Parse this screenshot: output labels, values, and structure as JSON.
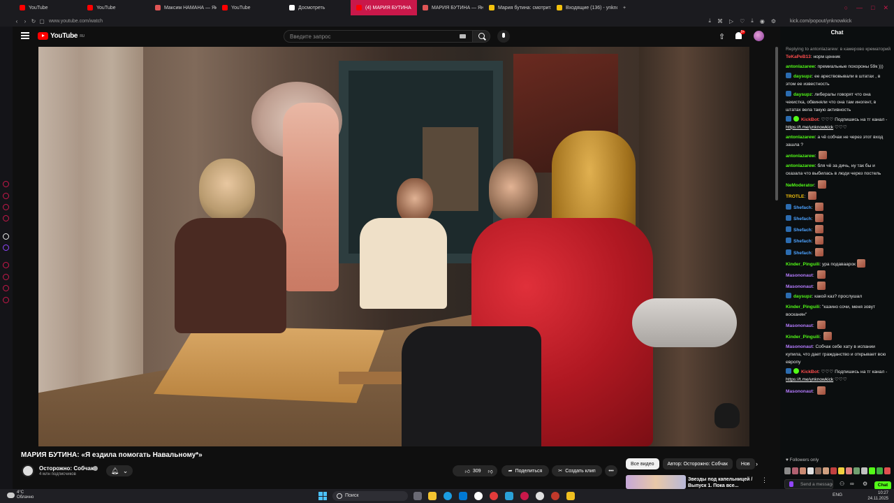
{
  "browser": {
    "tabs": [
      {
        "label": "YouTube",
        "favicon_color": "#ff0000",
        "active": false
      },
      {
        "label": "YouTube",
        "favicon_color": "#ff0000",
        "active": false
      },
      {
        "label": "Максим НАМАНА — Як...",
        "favicon_color": "#e05555",
        "active": false
      },
      {
        "label": "YouTube",
        "favicon_color": "#ff0000",
        "active": false
      },
      {
        "label": "Досмотреть",
        "favicon_color": "#ffffff",
        "active": false
      },
      {
        "label": "(4) МАРИЯ БУТИНА",
        "favicon_color": "#ff0000",
        "active": true
      },
      {
        "label": "МАРИЯ БУТИНА — Янд...",
        "favicon_color": "#e05555",
        "active": false
      },
      {
        "label": "Мария бутина: смотрит...",
        "favicon_color": "#f4c20d",
        "active": false
      },
      {
        "label": "Входящие (136) - ynkno...",
        "favicon_color": "#f4c20d",
        "active": false
      }
    ],
    "new_tab_label": "+",
    "url": "www.youtube.com/watch",
    "accent": "#c9184a"
  },
  "youtube": {
    "logo": "YouTube",
    "logo_region": "RU",
    "search_placeholder": "Введите запрос",
    "notification_count": "9+",
    "video": {
      "title": "МАРИЯ БУТИНА: «Я ездила помогать Навальному*»",
      "channel": "Осторожно: Собчак",
      "subscribers": "4 млн подписчиков",
      "likes": "309",
      "share_label": "Поделиться",
      "clip_label": "Создать клип",
      "more_label": "•••"
    },
    "filters": [
      "Все видео",
      "Автор: Осторожно: Собчак",
      "Нов"
    ],
    "recommended": {
      "title": "Звезды под капельницей / Выпуск 1. Пока все..."
    }
  },
  "chat": {
    "url": "kick.com/popout/ynknowkick",
    "header": "Chat",
    "messages": [
      {
        "reply": "Replying to antonlazarew: в камерово крематорий...",
        "user": "TeKaPeB13",
        "color": "#ff4d4d",
        "text": "норм ценник"
      },
      {
        "user": "antonlazarew",
        "color": "#53fc18",
        "text": "премиальные похороны 59к )))"
      },
      {
        "user": "daysupz",
        "color": "#53fc18",
        "badge": true,
        "text": "ее арествовывали в штатах , в этом ее известность"
      },
      {
        "user": "daysupz",
        "color": "#53fc18",
        "badge": true,
        "text": "либералы говорят что она чекистка, обвиняли что она там иногент, в штатах вела такую активность"
      },
      {
        "user": "KickBot",
        "color": "#ff4d4d",
        "badge": true,
        "bot": true,
        "text": "♡♡♡ Подпишись на тг канал - ",
        "link": "https://t.me/ynknowkick",
        "tail": " ♡♡♡"
      },
      {
        "user": "antonlazarew",
        "color": "#53fc18",
        "text": "а чё собчак не через этот вход зашла ?"
      },
      {
        "user": "antonlazarew",
        "color": "#53fc18",
        "emote": true,
        "text": ""
      },
      {
        "user": "antonlazarew",
        "color": "#53fc18",
        "text": "бля чё за дичь, ну так бы и сказала что выбилась в люди через постель"
      },
      {
        "user": "NeModerator",
        "color": "#53fc18",
        "emote": true,
        "text": ""
      },
      {
        "user": "TROTLE",
        "color": "#f4c20d",
        "emote": true,
        "text": ""
      },
      {
        "user": "Shefach",
        "color": "#4da3ff",
        "badge": true,
        "emote": true,
        "text": ""
      },
      {
        "user": "Shefach",
        "color": "#4da3ff",
        "badge": true,
        "emote": true,
        "text": ""
      },
      {
        "user": "Shefach",
        "color": "#4da3ff",
        "badge": true,
        "emote": true,
        "text": ""
      },
      {
        "user": "Shefach",
        "color": "#4da3ff",
        "badge": true,
        "emote": true,
        "text": ""
      },
      {
        "user": "Shefach",
        "color": "#4da3ff",
        "badge": true,
        "emote": true,
        "text": ""
      },
      {
        "user": "Kinder_Pinguili",
        "color": "#53fc18",
        "text": "ура подаваарок",
        "emote": true
      },
      {
        "user": "Masononaut",
        "color": "#b57cff",
        "emote": true,
        "text": ""
      },
      {
        "user": "Masononaut",
        "color": "#b57cff",
        "emote": true,
        "text": ""
      },
      {
        "user": "daysupz",
        "color": "#53fc18",
        "badge": true,
        "text": "какой каз? прослушал"
      },
      {
        "user": "Kinder_Pinguili",
        "color": "#53fc18",
        "text": "\"казино сочи, меня зовут восканян\""
      },
      {
        "user": "Masononaut",
        "color": "#b57cff",
        "emote": true,
        "text": ""
      },
      {
        "user": "Kinder_Pinguili",
        "color": "#53fc18",
        "emote": true,
        "text": ""
      },
      {
        "user": "Masononaut",
        "color": "#b57cff",
        "text": "Собчак себе хату в испании купила, что дает гражданство и открывает всю европу"
      },
      {
        "user": "KickBot",
        "color": "#ff4d4d",
        "badge": true,
        "bot": true,
        "text": "♡♡♡ Подпишись на тг канал - ",
        "link": "https://t.me/ynknowkick",
        "tail": " ♡♡♡"
      },
      {
        "user": "Masononaut",
        "color": "#b57cff",
        "emote": true,
        "text": ""
      }
    ],
    "followers_only": "Followers only",
    "input_placeholder": "Send a message",
    "send_label": "Chat"
  },
  "taskbar": {
    "temperature": "4°C",
    "weather": "Облачно",
    "search_label": "Поиск",
    "lang": "ENG",
    "time": "10:27",
    "date": "24.11.2025"
  }
}
